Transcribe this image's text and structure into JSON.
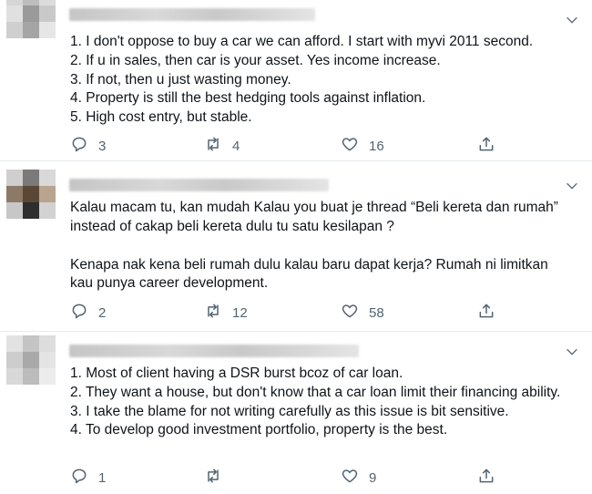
{
  "tweets": [
    {
      "lines": [
        "1. I don't oppose to buy a car we can afford. I start with myvi 2011 second.",
        "2. If u in sales, then car is your asset. Yes income increase.",
        "3. If not, then u just wasting money.",
        "4. Property is still the best hedging tools against inflation.",
        "5. High cost entry, but stable."
      ],
      "replies": "3",
      "retweets": "4",
      "likes": "16"
    },
    {
      "para1": "Kalau macam tu, kan mudah Kalau you buat je thread “Beli kereta dan rumah” instead of cakap beli kereta dulu tu satu kesilapan ?",
      "para2": "Kenapa nak kena beli rumah dulu kalau baru dapat kerja? Rumah ni limitkan kau punya career development.",
      "replies": "2",
      "retweets": "12",
      "likes": "58"
    },
    {
      "lines": [
        "1. Most of client having a DSR burst bcoz of car loan.",
        "2. They want a house, but don't know that a car loan limit their financing ability.",
        "3. I take the blame for not writing carefully as this issue is bit sensitive.",
        "4. To develop good investment portfolio, property is the best."
      ],
      "replies": "1",
      "retweets": "",
      "likes": "9"
    }
  ],
  "icons": [
    "reply-icon",
    "retweet-icon",
    "like-icon",
    "share-icon",
    "chevron-down-icon"
  ],
  "colors": {
    "text": "#0f1419",
    "muted": "#536471",
    "divider": "#e6ecf0"
  }
}
